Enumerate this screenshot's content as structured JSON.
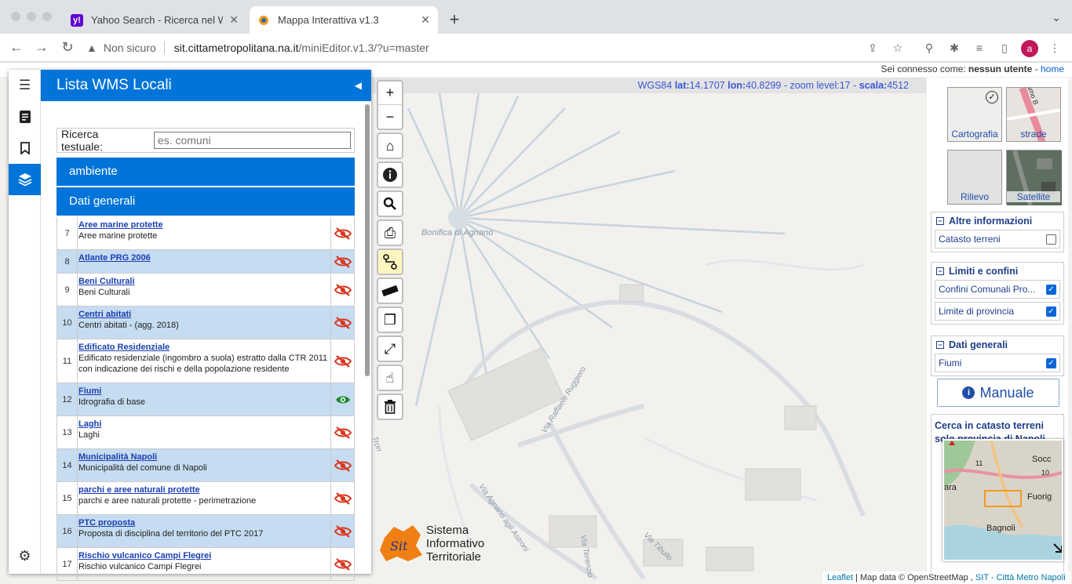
{
  "browser": {
    "tabs": [
      {
        "title": "Yahoo Search - Ricerca nel We",
        "favicon": "yahoo-icon",
        "active": false
      },
      {
        "title": "Mappa Interattiva v1.3",
        "favicon": "sit-icon",
        "active": true
      }
    ],
    "new_tab": "+",
    "security_label": "Non sicuro",
    "url_host": "sit.cittametropolitana.na.it",
    "url_path": "/miniEditor.v1.3/?u=master",
    "profile_initial": "a"
  },
  "userbar": {
    "prefix": "Sei connesso come:",
    "user": "nessun utente",
    "separator": "-",
    "home": "home"
  },
  "coords": {
    "crs": "WGS84",
    "lat_label": "lat:",
    "lat": "14.1707",
    "lon_label": "lon:",
    "lon": "40.8299",
    "zoom": "- zoom level:17 -",
    "scale_label": "scala:",
    "scale": "4512"
  },
  "sidebar": {
    "title": "Lista WMS Locali",
    "search_label": "Ricerca testuale:",
    "search_placeholder": "es. comuni",
    "groups": [
      "ambiente",
      "Dati generali"
    ],
    "layers": [
      {
        "num": "7",
        "name": "Aree marine protette",
        "desc": "Aree marine protette",
        "visible": false
      },
      {
        "num": "8",
        "name": "Atlante PRG 2006",
        "desc": "",
        "visible": false
      },
      {
        "num": "9",
        "name": "Beni Culturali",
        "desc": "Beni Culturali",
        "visible": false
      },
      {
        "num": "10",
        "name": "Centri abitati",
        "desc": "Centri abitati - (agg. 2018)",
        "visible": false
      },
      {
        "num": "11",
        "name": "Edificato Residenziale",
        "desc": "Edificato residenziale (ingombro a suola) estratto dalla CTR 2011 con indicazione dei rischi e della popolazione residente",
        "visible": false
      },
      {
        "num": "12",
        "name": "Fiumi",
        "desc": "Idrografia di base",
        "visible": true
      },
      {
        "num": "13",
        "name": "Laghi",
        "desc": "Laghi",
        "visible": false
      },
      {
        "num": "14",
        "name": "Municipalità Napoli",
        "desc": "Municipalità del comune di Napoli",
        "visible": false
      },
      {
        "num": "15",
        "name": "parchi e aree naturali protette",
        "desc": "parchi e aree naturali protette - perimetrazione",
        "visible": false
      },
      {
        "num": "16",
        "name": "PTC proposta",
        "desc": "Proposta di disciplina del territorio del PTC 2017",
        "visible": false
      },
      {
        "num": "17",
        "name": "Rischio vulcanico Campi Flegrei",
        "desc": "Rischio vulcanico Campi Flegrei",
        "visible": false
      }
    ]
  },
  "map": {
    "labels": {
      "place": "Bonifica di Agnano",
      "street1": "Via Raffaele Ruggiero",
      "street2": "Via Agnano agli Astroni",
      "street3": "Via Terenzio",
      "street4": "Via Tibullo",
      "street5": "Tron"
    },
    "attribution_leaflet": "Leaflet",
    "attribution_mid": "| Map data © OpenStreetMap ,",
    "attribution_sit": "SIT - Città Metro Napoli"
  },
  "logo": {
    "mark": "Sit",
    "line1": "Sistema",
    "line2": "Informativo",
    "line3": "Territoriale"
  },
  "rpanel": {
    "basemaps": [
      "Cartografia",
      "strade",
      "Rilievo",
      "Satellite"
    ],
    "road_label": "amo B",
    "legend": [
      {
        "title": "Altre informazioni",
        "items": [
          {
            "label": "Catasto terreni",
            "checked": false
          }
        ]
      },
      {
        "title": "Limiti e confini",
        "items": [
          {
            "label": "Confini Comunali Pro...",
            "checked": true
          },
          {
            "label": "Limite di provincia",
            "checked": true
          }
        ]
      },
      {
        "title": "Dati generali",
        "items": [
          {
            "label": "Fiumi",
            "checked": true
          }
        ]
      }
    ],
    "manuale": "Manuale",
    "catasto_title": "Cerca in catasto terreni solo provincia di Napoli",
    "minimap_labels": [
      "Socc",
      "Fuorig",
      "Bagnoli",
      "ara",
      "11",
      "10"
    ]
  },
  "colors": {
    "accent": "#0074d9",
    "eye_off": "#d9361e",
    "eye_on": "#1a8a2e"
  }
}
